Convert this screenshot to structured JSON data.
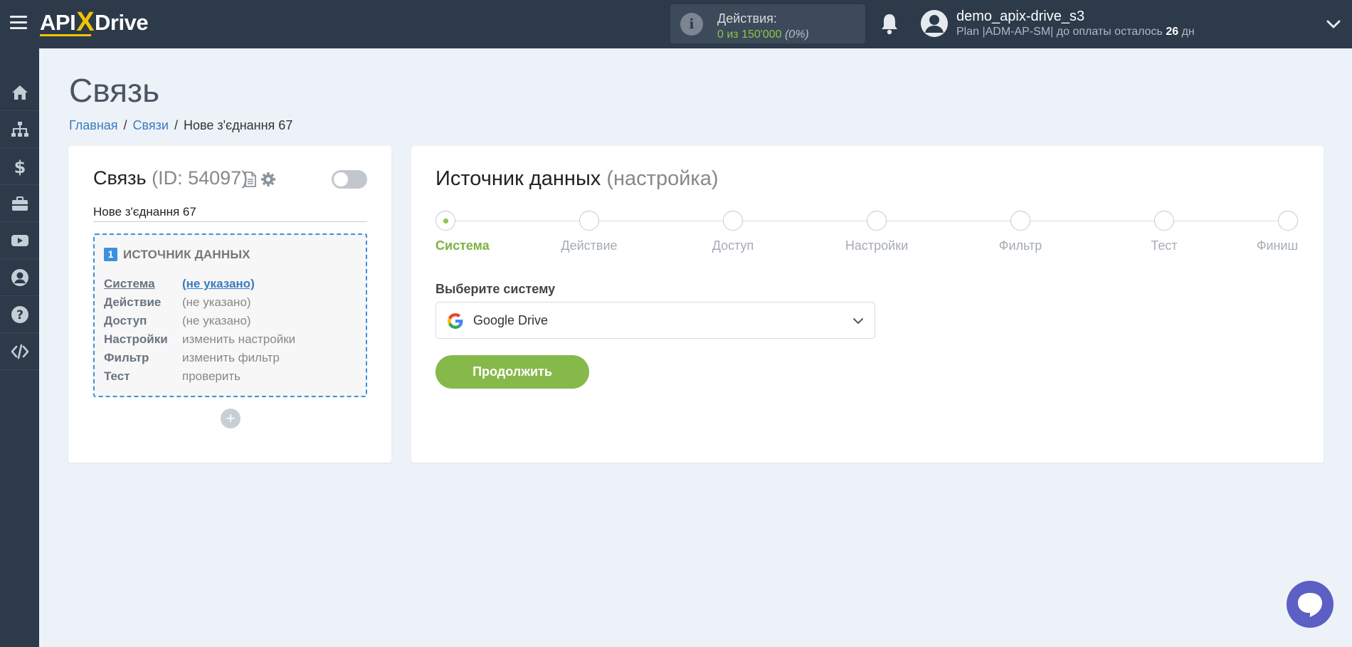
{
  "topbar": {
    "logo": {
      "left": "API",
      "x": "X",
      "right": "Drive"
    },
    "actions": {
      "title": "Действия:",
      "count": "0 из 150'000",
      "percent": "(0%)"
    },
    "user": {
      "name": "demo_apix-drive_s3",
      "plan_prefix": "Plan |ADM-AP-SM| до оплаты осталось ",
      "days_num": "26",
      "days_unit": " дн"
    }
  },
  "sidebar": {
    "items": [
      {
        "icon": "home-icon"
      },
      {
        "icon": "sitemap-icon"
      },
      {
        "icon": "dollar-icon"
      },
      {
        "icon": "briefcase-icon"
      },
      {
        "icon": "video-icon"
      },
      {
        "icon": "user-icon"
      },
      {
        "icon": "question-icon"
      },
      {
        "icon": "code-icon"
      }
    ]
  },
  "page": {
    "title": "Связь",
    "breadcrumb": [
      "Главная",
      "Связи",
      "Нове з'єднання 67"
    ]
  },
  "connection": {
    "title": "Связь",
    "id_text": "(ID: 54097)",
    "name": "Нове з'єднання 67",
    "toggle_on": false,
    "source": {
      "number": "1",
      "title": "ИСТОЧНИК ДАННЫХ",
      "rows": [
        {
          "key": "Система",
          "value": "(не указано)"
        },
        {
          "key": "Действие",
          "value": "(не указано)"
        },
        {
          "key": "Доступ",
          "value": "(не указано)"
        },
        {
          "key": "Настройки",
          "value": "изменить настройки"
        },
        {
          "key": "Фильтр",
          "value": "изменить фильтр"
        },
        {
          "key": "Тест",
          "value": "проверить"
        }
      ]
    },
    "add_symbol": "+"
  },
  "setup": {
    "heading": "Источник данных",
    "heading_sub": "(настройка)",
    "steps": [
      "Система",
      "Действие",
      "Доступ",
      "Настройки",
      "Фильтр",
      "Тест",
      "Финиш"
    ],
    "active_step": 0,
    "field_label": "Выберите систему",
    "selected_system": "Google Drive",
    "continue_label": "Продолжить"
  },
  "colors": {
    "topbar": "#2c3a4a",
    "accent_green": "#86b94a",
    "link_blue": "#3b7bbf",
    "dashed_blue": "#3d8fe0",
    "logo_yellow": "#f5c400",
    "chat": "#5c5fc4"
  }
}
